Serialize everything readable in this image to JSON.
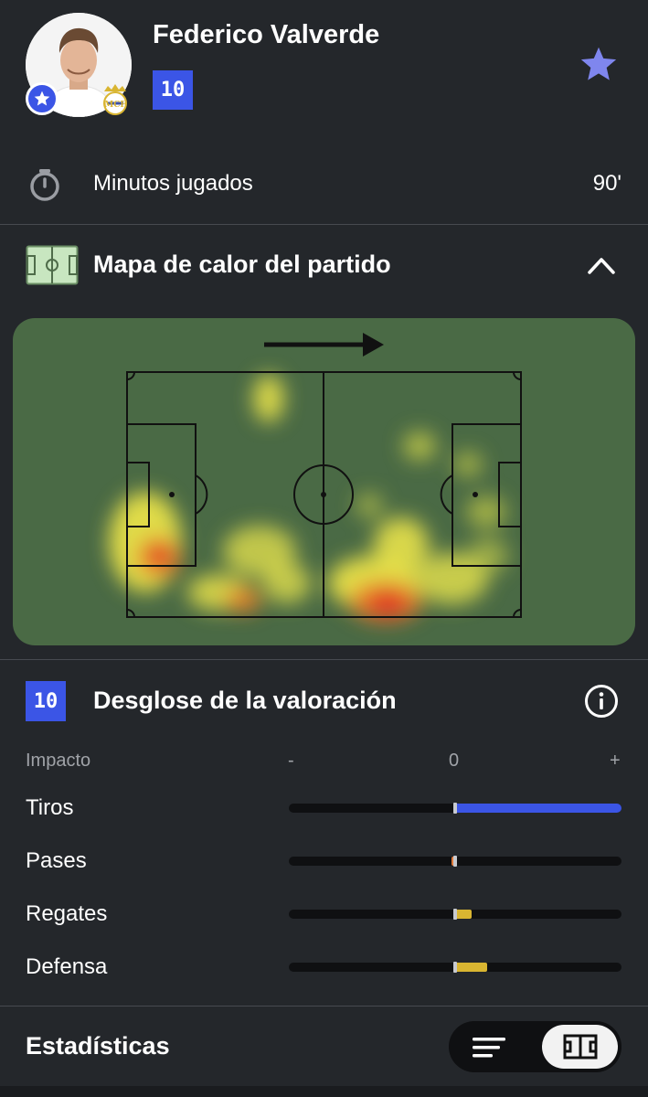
{
  "player": {
    "name": "Federico Valverde",
    "rating": "10",
    "club_icon": "real-madrid-crest-icon"
  },
  "header": {
    "favorite_icon": "star-icon"
  },
  "minutes": {
    "label": "Minutos jugados",
    "value": "90'"
  },
  "heatmap": {
    "title": "Mapa de calor del partido",
    "attack_direction": "right"
  },
  "breakdown": {
    "rating": "10",
    "title": "Desglose de la valoración",
    "scale": {
      "label": "Impacto",
      "minus": "-",
      "zero": "0",
      "plus": "+"
    },
    "items": [
      {
        "label": "Tiros",
        "impact": 1.0,
        "color": "#3b55e6"
      },
      {
        "label": "Pases",
        "impact": -0.02,
        "color": "#e07a3a"
      },
      {
        "label": "Regates",
        "impact": 0.1,
        "color": "#d9b531"
      },
      {
        "label": "Defensa",
        "impact": 0.19,
        "color": "#d9b531"
      }
    ]
  },
  "footer": {
    "title": "Estadísticas",
    "view_toggle": {
      "options": [
        "list",
        "pitch"
      ],
      "selected": "pitch"
    }
  },
  "colors": {
    "background": "#24272b",
    "accent": "#3b55e6",
    "pitch": "#4a6a45"
  }
}
